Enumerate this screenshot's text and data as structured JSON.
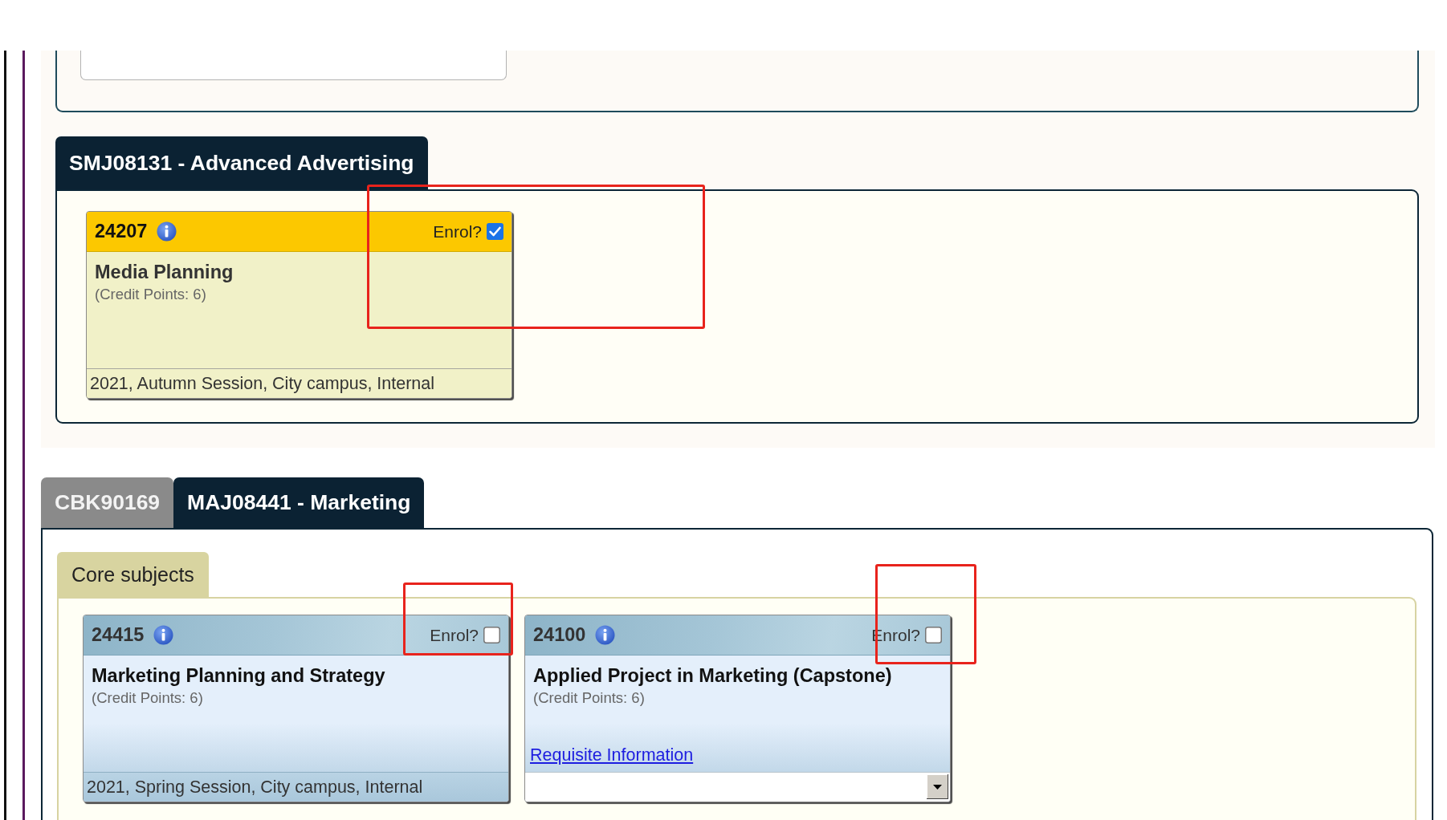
{
  "upper_section": {
    "tabs": [
      {
        "label": "SMJ08131 - Advanced Advertising",
        "selected": true
      }
    ],
    "cards": [
      {
        "code": "24207",
        "enrol_label": "Enrol?",
        "enrol_checked": true,
        "highlighted": true,
        "title": "Media Planning",
        "credit_points": "(Credit Points: 6)",
        "footer": {
          "kind": "session",
          "text": "2021, Autumn Session, City campus, Internal"
        }
      }
    ]
  },
  "lower_section": {
    "tabs": [
      {
        "label": "CBK90169",
        "selected": false
      },
      {
        "label": "MAJ08441 - Marketing",
        "selected": true
      }
    ],
    "subtabs": [
      {
        "label": "Core subjects",
        "selected": true
      }
    ],
    "cards": [
      {
        "code": "24415",
        "enrol_label": "Enrol?",
        "enrol_checked": false,
        "highlighted": true,
        "title": "Marketing Planning and Strategy",
        "credit_points": "(Credit Points: 6)",
        "footer": {
          "kind": "session",
          "text": "2021, Spring Session, City campus, Internal"
        }
      },
      {
        "code": "24100",
        "enrol_label": "Enrol?",
        "enrol_checked": false,
        "highlighted": true,
        "title": "Applied Project in Marketing (Capstone)",
        "credit_points": "(Credit Points: 6)",
        "link": "Requisite Information",
        "footer": {
          "kind": "dropdown"
        }
      }
    ]
  }
}
